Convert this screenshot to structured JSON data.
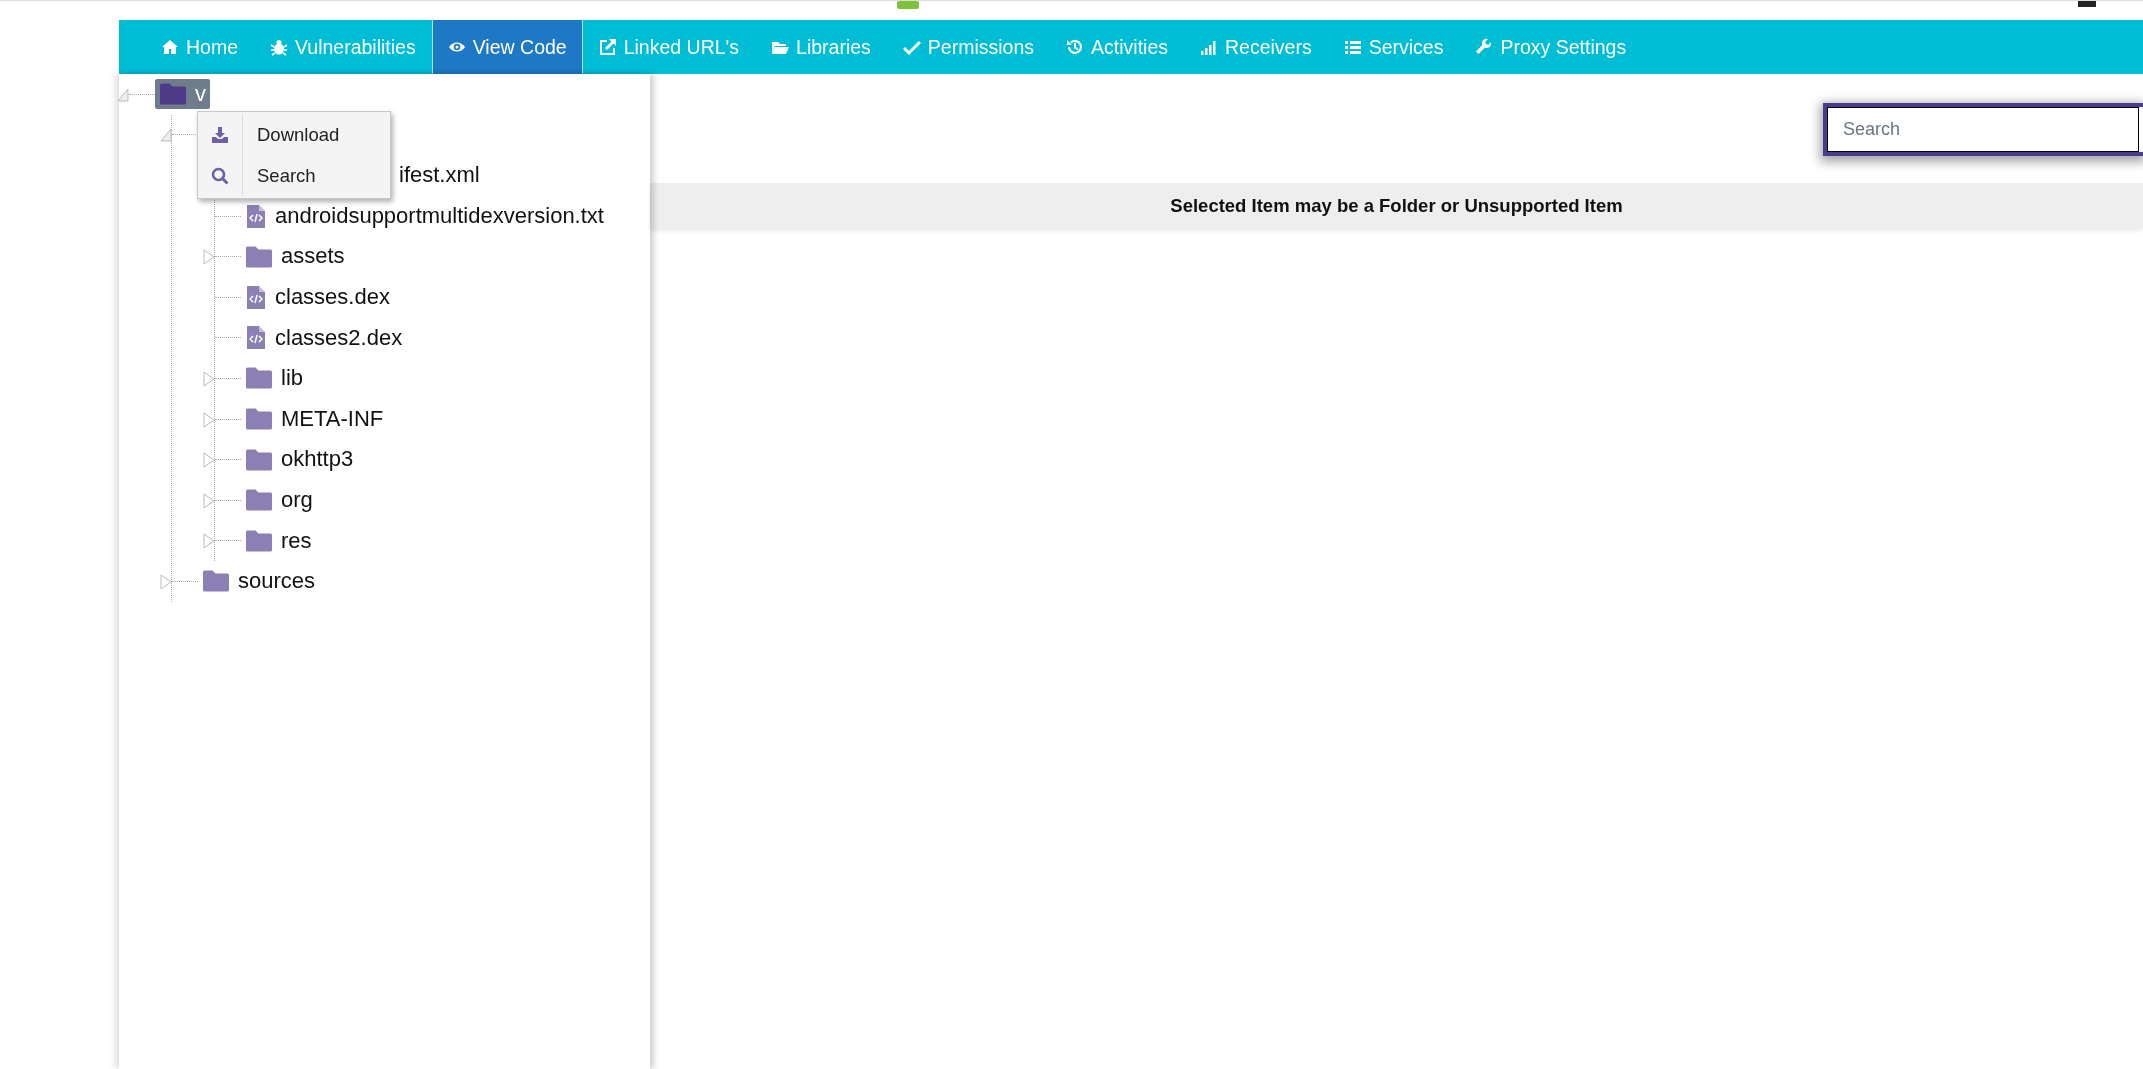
{
  "nav": [
    {
      "label": "Home",
      "selected": false
    },
    {
      "label": "Vulnerabilities",
      "selected": false
    },
    {
      "label": "View Code",
      "selected": true
    },
    {
      "label": "Linked URL's",
      "selected": false
    },
    {
      "label": "Libraries",
      "selected": false
    },
    {
      "label": "Permissions",
      "selected": false
    },
    {
      "label": "Activities",
      "selected": false
    },
    {
      "label": "Receivers",
      "selected": false
    },
    {
      "label": "Services",
      "selected": false
    },
    {
      "label": "Proxy Settings",
      "selected": false
    }
  ],
  "tree": [
    {
      "kind": "folder",
      "label": "v",
      "selected": true,
      "expanded": true,
      "children": [
        {
          "kind": "folder",
          "expanded": true,
          "covered": true,
          "children": [
            {
              "kind": "file",
              "label": "ifest.xml",
              "covered": true
            },
            {
              "kind": "file",
              "label": "androidsupportmultidexversion.txt"
            },
            {
              "kind": "folder",
              "label": "assets",
              "expanded": false
            },
            {
              "kind": "file",
              "label": "classes.dex"
            },
            {
              "kind": "file",
              "label": "classes2.dex"
            },
            {
              "kind": "folder",
              "label": "lib",
              "expanded": false
            },
            {
              "kind": "folder",
              "label": "META-INF",
              "expanded": false
            },
            {
              "kind": "folder",
              "label": "okhttp3",
              "expanded": false
            },
            {
              "kind": "folder",
              "label": "org",
              "expanded": false
            },
            {
              "kind": "folder",
              "label": "res",
              "expanded": false
            }
          ]
        },
        {
          "kind": "folder",
          "label": "sources",
          "expanded": false
        }
      ]
    }
  ],
  "context_menu": [
    {
      "label": "Download"
    },
    {
      "label": "Search"
    }
  ],
  "search": {
    "placeholder": "Search"
  },
  "message": "Selected Item may be a Folder or Unsupported Item"
}
